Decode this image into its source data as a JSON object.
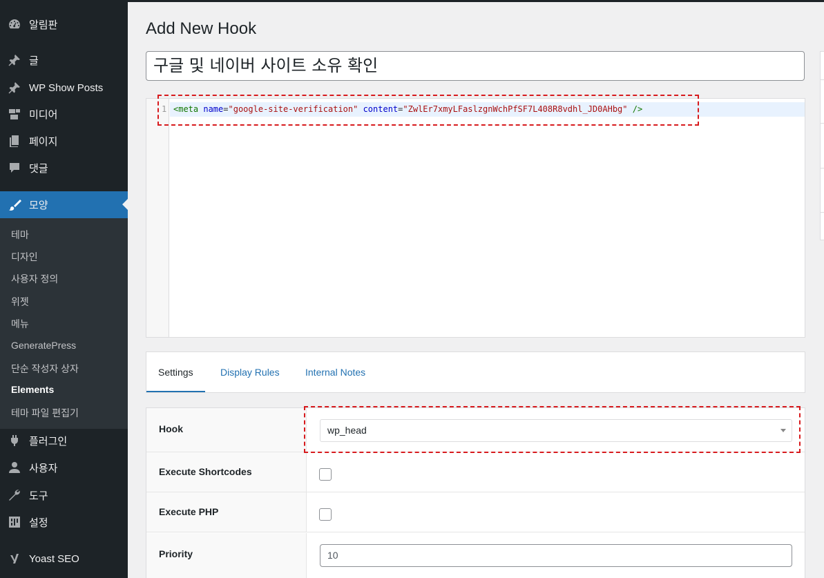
{
  "sidebar": {
    "menu": [
      {
        "label": "알림판",
        "icon": "dashboard-icon"
      },
      {
        "label": "글",
        "icon": "pin-icon"
      },
      {
        "label": "WP Show Posts",
        "icon": "pin-icon"
      },
      {
        "label": "미디어",
        "icon": "media-icon"
      },
      {
        "label": "페이지",
        "icon": "page-icon"
      },
      {
        "label": "댓글",
        "icon": "comment-icon"
      },
      {
        "label": "모양",
        "icon": "brush-icon",
        "active": true
      },
      {
        "label": "플러그인",
        "icon": "plugin-icon"
      },
      {
        "label": "사용자",
        "icon": "user-icon"
      },
      {
        "label": "도구",
        "icon": "wrench-icon"
      },
      {
        "label": "설정",
        "icon": "settings-icon"
      },
      {
        "label": "Yoast SEO",
        "icon": "yoast-icon"
      }
    ],
    "submenu": [
      {
        "label": "테마"
      },
      {
        "label": "디자인"
      },
      {
        "label": "사용자 정의"
      },
      {
        "label": "위젯"
      },
      {
        "label": "메뉴"
      },
      {
        "label": "GeneratePress"
      },
      {
        "label": "단순 작성자 상자"
      },
      {
        "label": "Elements",
        "current": true
      },
      {
        "label": "테마 파일 편집기"
      }
    ]
  },
  "page": {
    "title": "Add New Hook",
    "hook_title": "구글 및 네이버 사이트 소유 확인"
  },
  "editor": {
    "line_number": "1",
    "code": {
      "open": "<meta",
      "attr1": "name",
      "val1": "\"google-site-verification\"",
      "attr2": "content",
      "val2": "\"ZwlEr7xmyLFaslzgnWchPfSF7L408R8vdhl_JD0AHbg\"",
      "close": "/>"
    }
  },
  "tabs": [
    {
      "label": "Settings",
      "active": true
    },
    {
      "label": "Display Rules"
    },
    {
      "label": "Internal Notes"
    }
  ],
  "settings": {
    "hook": {
      "label": "Hook",
      "value": "wp_head"
    },
    "execute_shortcodes": {
      "label": "Execute Shortcodes",
      "checked": false
    },
    "execute_php": {
      "label": "Execute PHP",
      "checked": false
    },
    "priority": {
      "label": "Priority",
      "value": "10"
    }
  },
  "colors": {
    "sidebar_bg": "#1d2327",
    "active_menu": "#2271b1",
    "highlight": "#d7191c"
  }
}
